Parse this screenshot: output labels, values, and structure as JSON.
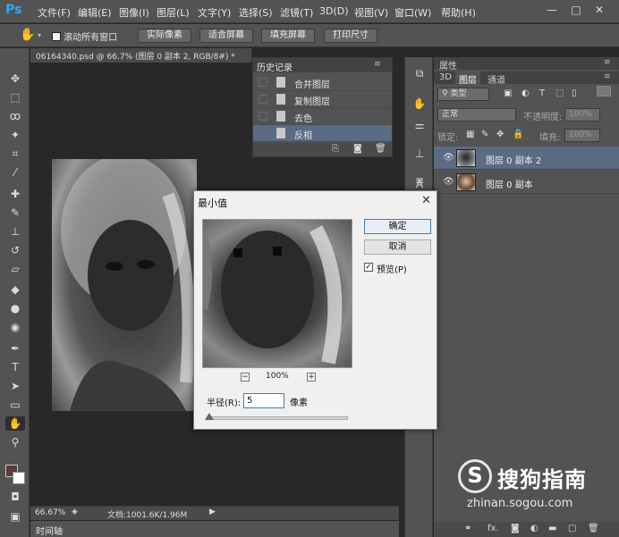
{
  "app": {
    "logo": "Ps"
  },
  "menu": [
    "文件(F)",
    "编辑(E)",
    "图像(I)",
    "图层(L)",
    "文字(Y)",
    "选择(S)",
    "滤镜(T)",
    "3D(D)",
    "视图(V)",
    "窗口(W)",
    "帮助(H)"
  ],
  "window_controls": {
    "minimize": "—",
    "maximize": "□",
    "close": "✕"
  },
  "options_bar": {
    "scroll_all_windows": "滚动所有窗口",
    "scroll_all_checked": false,
    "buttons": [
      "实际像素",
      "适合屏幕",
      "填充屏幕",
      "打印尺寸"
    ]
  },
  "document": {
    "tab_title": "06164340.psd @ 66.7% (图层 0 副本 2, RGB/8#) *",
    "tab_close": "×"
  },
  "history": {
    "title": "历史记录",
    "items": [
      {
        "label": "合并图层",
        "active": false
      },
      {
        "label": "复制图层",
        "active": false
      },
      {
        "label": "去色",
        "active": false
      },
      {
        "label": "反相",
        "active": true
      }
    ]
  },
  "properties_panel": {
    "title": "属性"
  },
  "layers_panel": {
    "tabs": [
      "3D",
      "图层",
      "通道"
    ],
    "active_tab": "图层",
    "filter_kind": "类型",
    "blend_mode": "正常",
    "opacity_label": "不透明度:",
    "opacity_value": "100%",
    "lock_label": "锁定:",
    "fill_label": "填充:",
    "fill_value": "100%",
    "layers": [
      {
        "name": "图层 0 副本 2",
        "active": true
      },
      {
        "name": "图层 0 副本",
        "active": false
      }
    ],
    "footer_icons": [
      "link-icon",
      "fx-icon",
      "mask-icon",
      "adjustment-icon",
      "folder-icon",
      "new-layer-icon",
      "trash-icon"
    ]
  },
  "dialog": {
    "title": "最小值",
    "ok_label": "确定",
    "cancel_label": "取消",
    "preview_label": "预览(P)",
    "preview_checked": true,
    "zoom_level": "100%",
    "radius_label": "半径(R):",
    "radius_value": "5",
    "radius_unit": "像素"
  },
  "status": {
    "zoom": "66.67%",
    "doc_info": "文档:1001.6K/1.96M"
  },
  "timeline": {
    "label": "时间轴"
  },
  "watermark": {
    "logo_letter": "S",
    "text": "搜狗指南",
    "url": "zhinan.sogou.com"
  }
}
